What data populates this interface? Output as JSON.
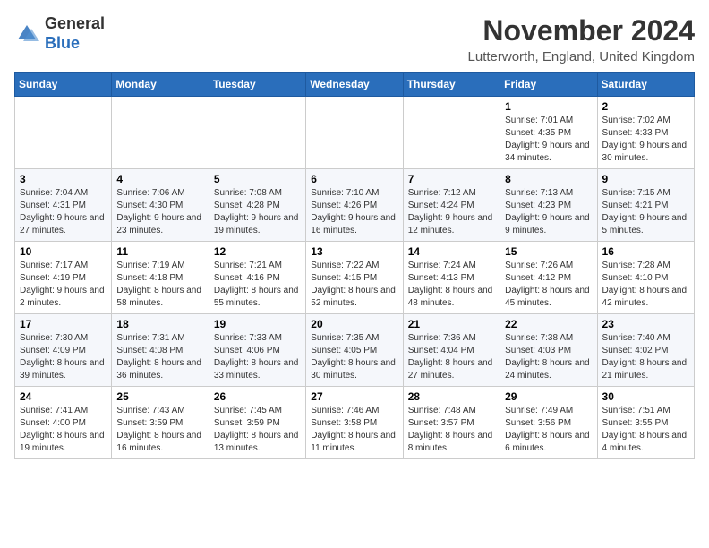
{
  "logo": {
    "general": "General",
    "blue": "Blue"
  },
  "header": {
    "month_title": "November 2024",
    "location": "Lutterworth, England, United Kingdom"
  },
  "days_of_week": [
    "Sunday",
    "Monday",
    "Tuesday",
    "Wednesday",
    "Thursday",
    "Friday",
    "Saturday"
  ],
  "weeks": [
    [
      {
        "day": "",
        "info": ""
      },
      {
        "day": "",
        "info": ""
      },
      {
        "day": "",
        "info": ""
      },
      {
        "day": "",
        "info": ""
      },
      {
        "day": "",
        "info": ""
      },
      {
        "day": "1",
        "info": "Sunrise: 7:01 AM\nSunset: 4:35 PM\nDaylight: 9 hours and 34 minutes."
      },
      {
        "day": "2",
        "info": "Sunrise: 7:02 AM\nSunset: 4:33 PM\nDaylight: 9 hours and 30 minutes."
      }
    ],
    [
      {
        "day": "3",
        "info": "Sunrise: 7:04 AM\nSunset: 4:31 PM\nDaylight: 9 hours and 27 minutes."
      },
      {
        "day": "4",
        "info": "Sunrise: 7:06 AM\nSunset: 4:30 PM\nDaylight: 9 hours and 23 minutes."
      },
      {
        "day": "5",
        "info": "Sunrise: 7:08 AM\nSunset: 4:28 PM\nDaylight: 9 hours and 19 minutes."
      },
      {
        "day": "6",
        "info": "Sunrise: 7:10 AM\nSunset: 4:26 PM\nDaylight: 9 hours and 16 minutes."
      },
      {
        "day": "7",
        "info": "Sunrise: 7:12 AM\nSunset: 4:24 PM\nDaylight: 9 hours and 12 minutes."
      },
      {
        "day": "8",
        "info": "Sunrise: 7:13 AM\nSunset: 4:23 PM\nDaylight: 9 hours and 9 minutes."
      },
      {
        "day": "9",
        "info": "Sunrise: 7:15 AM\nSunset: 4:21 PM\nDaylight: 9 hours and 5 minutes."
      }
    ],
    [
      {
        "day": "10",
        "info": "Sunrise: 7:17 AM\nSunset: 4:19 PM\nDaylight: 9 hours and 2 minutes."
      },
      {
        "day": "11",
        "info": "Sunrise: 7:19 AM\nSunset: 4:18 PM\nDaylight: 8 hours and 58 minutes."
      },
      {
        "day": "12",
        "info": "Sunrise: 7:21 AM\nSunset: 4:16 PM\nDaylight: 8 hours and 55 minutes."
      },
      {
        "day": "13",
        "info": "Sunrise: 7:22 AM\nSunset: 4:15 PM\nDaylight: 8 hours and 52 minutes."
      },
      {
        "day": "14",
        "info": "Sunrise: 7:24 AM\nSunset: 4:13 PM\nDaylight: 8 hours and 48 minutes."
      },
      {
        "day": "15",
        "info": "Sunrise: 7:26 AM\nSunset: 4:12 PM\nDaylight: 8 hours and 45 minutes."
      },
      {
        "day": "16",
        "info": "Sunrise: 7:28 AM\nSunset: 4:10 PM\nDaylight: 8 hours and 42 minutes."
      }
    ],
    [
      {
        "day": "17",
        "info": "Sunrise: 7:30 AM\nSunset: 4:09 PM\nDaylight: 8 hours and 39 minutes."
      },
      {
        "day": "18",
        "info": "Sunrise: 7:31 AM\nSunset: 4:08 PM\nDaylight: 8 hours and 36 minutes."
      },
      {
        "day": "19",
        "info": "Sunrise: 7:33 AM\nSunset: 4:06 PM\nDaylight: 8 hours and 33 minutes."
      },
      {
        "day": "20",
        "info": "Sunrise: 7:35 AM\nSunset: 4:05 PM\nDaylight: 8 hours and 30 minutes."
      },
      {
        "day": "21",
        "info": "Sunrise: 7:36 AM\nSunset: 4:04 PM\nDaylight: 8 hours and 27 minutes."
      },
      {
        "day": "22",
        "info": "Sunrise: 7:38 AM\nSunset: 4:03 PM\nDaylight: 8 hours and 24 minutes."
      },
      {
        "day": "23",
        "info": "Sunrise: 7:40 AM\nSunset: 4:02 PM\nDaylight: 8 hours and 21 minutes."
      }
    ],
    [
      {
        "day": "24",
        "info": "Sunrise: 7:41 AM\nSunset: 4:00 PM\nDaylight: 8 hours and 19 minutes."
      },
      {
        "day": "25",
        "info": "Sunrise: 7:43 AM\nSunset: 3:59 PM\nDaylight: 8 hours and 16 minutes."
      },
      {
        "day": "26",
        "info": "Sunrise: 7:45 AM\nSunset: 3:59 PM\nDaylight: 8 hours and 13 minutes."
      },
      {
        "day": "27",
        "info": "Sunrise: 7:46 AM\nSunset: 3:58 PM\nDaylight: 8 hours and 11 minutes."
      },
      {
        "day": "28",
        "info": "Sunrise: 7:48 AM\nSunset: 3:57 PM\nDaylight: 8 hours and 8 minutes."
      },
      {
        "day": "29",
        "info": "Sunrise: 7:49 AM\nSunset: 3:56 PM\nDaylight: 8 hours and 6 minutes."
      },
      {
        "day": "30",
        "info": "Sunrise: 7:51 AM\nSunset: 3:55 PM\nDaylight: 8 hours and 4 minutes."
      }
    ]
  ]
}
